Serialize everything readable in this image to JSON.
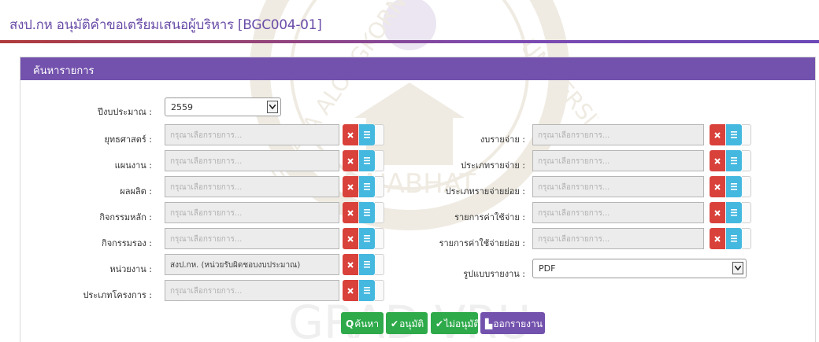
{
  "header": {
    "title": "สงป.กห อนุมัติคำขอเตรียมเสนอผู้บริหาร [BGC004-01]"
  },
  "watermark": {
    "text_bottom": "GRAD VRU",
    "text_arc_left": "VALAYA ALONGKORN",
    "text_arc_right": "UNIVERSITY",
    "text_center": "RAJABHAT"
  },
  "panel": {
    "heading": "ค้นหารายการ"
  },
  "form": {
    "placeholder": "กรุณาเลือกรายการ...",
    "fiscal_year": {
      "label": "ปีงบประมาณ :",
      "value": "2559"
    },
    "left": [
      {
        "label": "ยุทธศาสตร์ :",
        "value": ""
      },
      {
        "label": "แผนงาน :",
        "value": ""
      },
      {
        "label": "ผลผลิต :",
        "value": ""
      },
      {
        "label": "กิจกรรมหลัก :",
        "value": ""
      },
      {
        "label": "กิจกรรมรอง :",
        "value": ""
      },
      {
        "label": "หน่วยงาน :",
        "value": "สงป.กห. (หน่วยรับผิดชอบงบประมาณ)"
      },
      {
        "label": "ประเภทโครงการ :",
        "value": ""
      }
    ],
    "right": [
      {
        "label": "งบรายจ่าย :",
        "value": ""
      },
      {
        "label": "ประเภทรายจ่าย :",
        "value": ""
      },
      {
        "label": "ประเภทรายจ่ายย่อย :",
        "value": ""
      },
      {
        "label": "รายการค่าใช้จ่าย :",
        "value": ""
      },
      {
        "label": "รายการค่าใช้จ่ายย่อย :",
        "value": ""
      }
    ],
    "report_format": {
      "label": "รูปแบบรายงาน :",
      "value": "PDF"
    }
  },
  "actions": {
    "search": "ค้นหา",
    "approve": "อนุมัติ",
    "reject": "ไม่อนุมัติ",
    "report": "ออกรายงาน"
  },
  "colors": {
    "accent": "#7352ad",
    "danger": "#d9413b",
    "info": "#45b8e0",
    "success": "#2eaa4a"
  }
}
